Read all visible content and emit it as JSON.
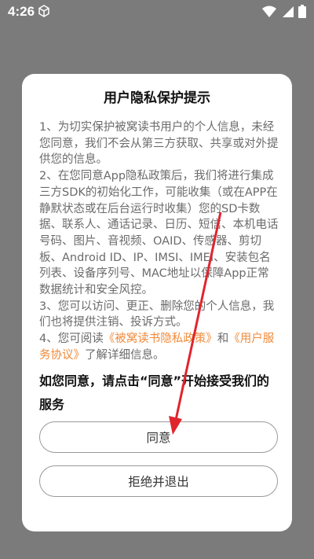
{
  "status_bar": {
    "time": "4:26"
  },
  "dialog": {
    "title": "用户隐私保护提示",
    "p1": "1、为切实保护被窝读书用户的个人信息，未经您同意，我们不会从第三方获取、共享或对外提供您的信息。",
    "p2": "2、在您同意App隐私政策后，我们将进行集成三方SDK的初始化工作，可能收集（或在APP在静默状态或在后台运行时收集）您的SD卡数据、联系人、通话记录、日历、短信、本机电话号码、图片、音视频、OAID、传感器、剪切板、Android ID、IP、IMSI、IMEI、安装包名列表、设备序列号、MAC地址以保障App正常数据统计和安全风控。",
    "p3": "3、您可以访问、更正、删除您的个人信息，我们也将提供注销、投诉方式。",
    "p4_prefix": "4、您可阅读",
    "privacy_link": "《被窝读书隐私政策》",
    "p4_and": "和",
    "service_link": "《用户服务协议》",
    "p4_suffix": "了解详细信息。",
    "consent": "如您同意，请点击“同意”开始接受我们的服务",
    "agree_label": "同意",
    "reject_label": "拒绝并退出"
  },
  "colors": {
    "accent": "#f08a3a",
    "arrow": "#e0252f"
  }
}
